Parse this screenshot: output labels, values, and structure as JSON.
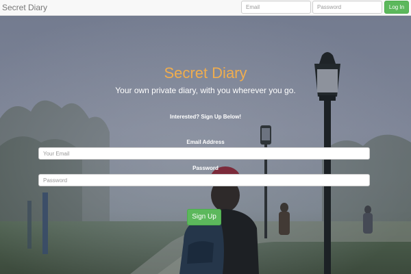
{
  "navbar": {
    "brand": "Secret Diary",
    "email_placeholder": "Email",
    "password_placeholder": "Password",
    "login_label": "Log In"
  },
  "hero": {
    "title": "Secret Diary",
    "tagline": "Your own private diary, with you wherever you go.",
    "signup_intro": "Interested? Sign Up Below!",
    "email_label": "Email Address",
    "email_placeholder": "Your Email",
    "password_label": "Password",
    "password_placeholder": "Password",
    "signup_label": "Sign Up"
  },
  "colors": {
    "accent_title": "#f0ad4e",
    "button_green": "#5cb85c",
    "navbar_bg": "#f8f8f8"
  },
  "background": {
    "description_icon": "foggy-park-photo"
  }
}
